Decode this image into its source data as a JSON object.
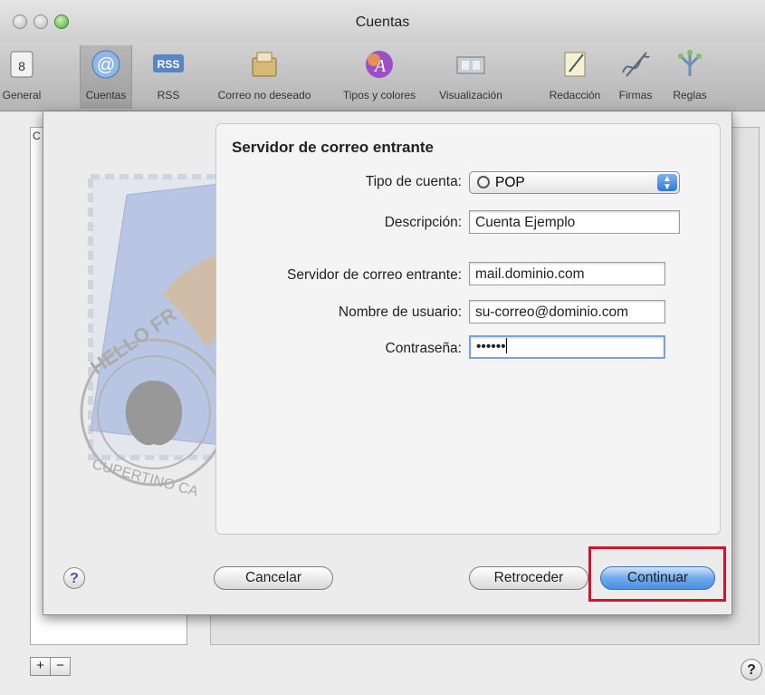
{
  "window": {
    "title": "Cuentas"
  },
  "toolbar": {
    "items": [
      {
        "label": "General",
        "icon": "general-icon"
      },
      {
        "label": "Cuentas",
        "icon": "at-sign-icon"
      },
      {
        "label": "RSS",
        "icon": "rss-icon"
      },
      {
        "label": "Correo no deseado",
        "icon": "junk-mail-icon"
      },
      {
        "label": "Tipos y colores",
        "icon": "fonts-colors-icon"
      },
      {
        "label": "Visualización",
        "icon": "viewing-icon"
      },
      {
        "label": "Redacción",
        "icon": "composing-icon"
      },
      {
        "label": "Firmas",
        "icon": "signatures-icon"
      },
      {
        "label": "Reglas",
        "icon": "rules-icon"
      }
    ],
    "selected": "Cuentas"
  },
  "accounts_list": {
    "header_fragment": "C",
    "add_label": "+",
    "remove_label": "−"
  },
  "main_help_label": "?",
  "sheet": {
    "heading": "Servidor de correo entrante",
    "fields": {
      "account_type": {
        "label": "Tipo de cuenta:",
        "value": "POP"
      },
      "description": {
        "label": "Descripción:",
        "value": "Cuenta Ejemplo"
      },
      "incoming_server": {
        "label": "Servidor de correo entrante:",
        "value": "mail.dominio.com"
      },
      "username": {
        "label": "Nombre de usuario:",
        "value": "su-correo@dominio.com"
      },
      "password": {
        "label": "Contraseña:",
        "value": "••••••"
      }
    },
    "help_label": "?",
    "buttons": {
      "cancel": "Cancelar",
      "back": "Retroceder",
      "continue": "Continuar"
    },
    "stamp_text": {
      "top": "HELLO FR",
      "bottom": "CUPERTINO CA"
    }
  },
  "colors": {
    "accent": "#4c8fe3",
    "highlight": "#d4122b"
  }
}
